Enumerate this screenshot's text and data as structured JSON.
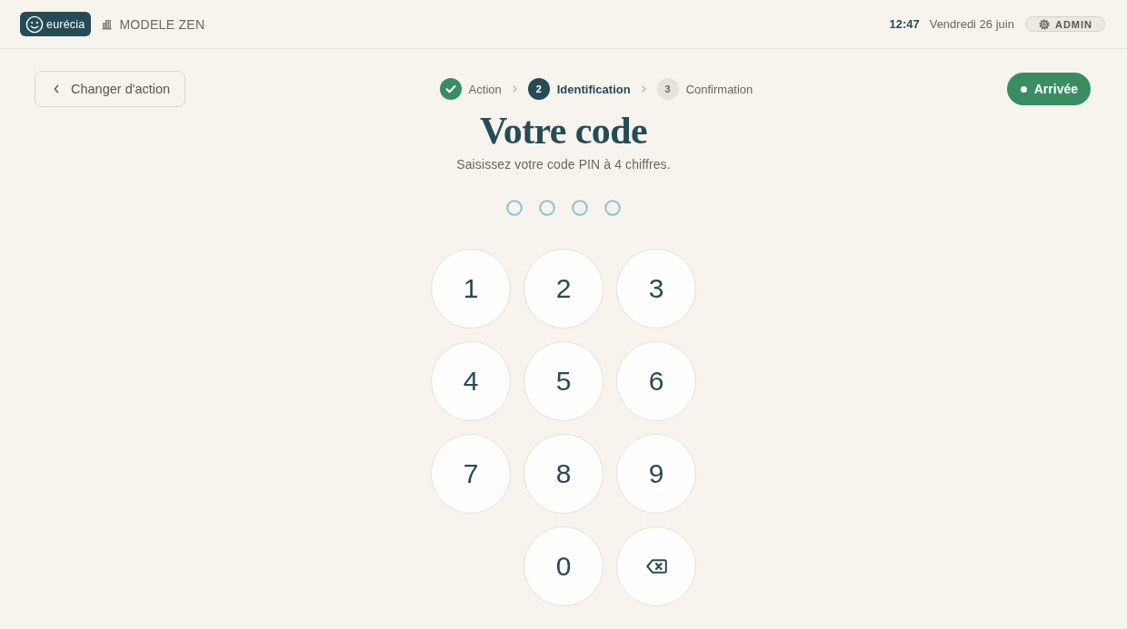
{
  "header": {
    "logo": "eurécia",
    "company": "MODELE ZEN",
    "time": "12:47",
    "date": "Vendredi 26 juin",
    "role": "ADMIN"
  },
  "back_button": {
    "label": "Changer d'action"
  },
  "steps": [
    {
      "label": "Action",
      "completed": true,
      "selected": false
    },
    {
      "number": "2",
      "label": "Identification",
      "completed": false,
      "selected": true
    },
    {
      "number": "3",
      "label": "Confirmation",
      "completed": false,
      "selected": false
    }
  ],
  "action_button": {
    "label": "Arrivée"
  },
  "title": "Votre code",
  "subtitle": "Saisissez votre code PIN à 4 chiffres.",
  "pin_dots": [
    {
      "filled": false
    },
    {
      "filled": false
    },
    {
      "filled": false
    },
    {
      "filled": false
    }
  ],
  "keypad": [
    {
      "kind": "digit",
      "label": "1"
    },
    {
      "kind": "digit",
      "label": "2"
    },
    {
      "kind": "digit",
      "label": "3"
    },
    {
      "kind": "digit",
      "label": "4"
    },
    {
      "kind": "digit",
      "label": "5"
    },
    {
      "kind": "digit",
      "label": "6"
    },
    {
      "kind": "digit",
      "label": "7"
    },
    {
      "kind": "digit",
      "label": "8"
    },
    {
      "kind": "digit",
      "label": "9"
    },
    {
      "kind": "digit",
      "label": "0"
    },
    {
      "kind": "backspace"
    }
  ]
}
